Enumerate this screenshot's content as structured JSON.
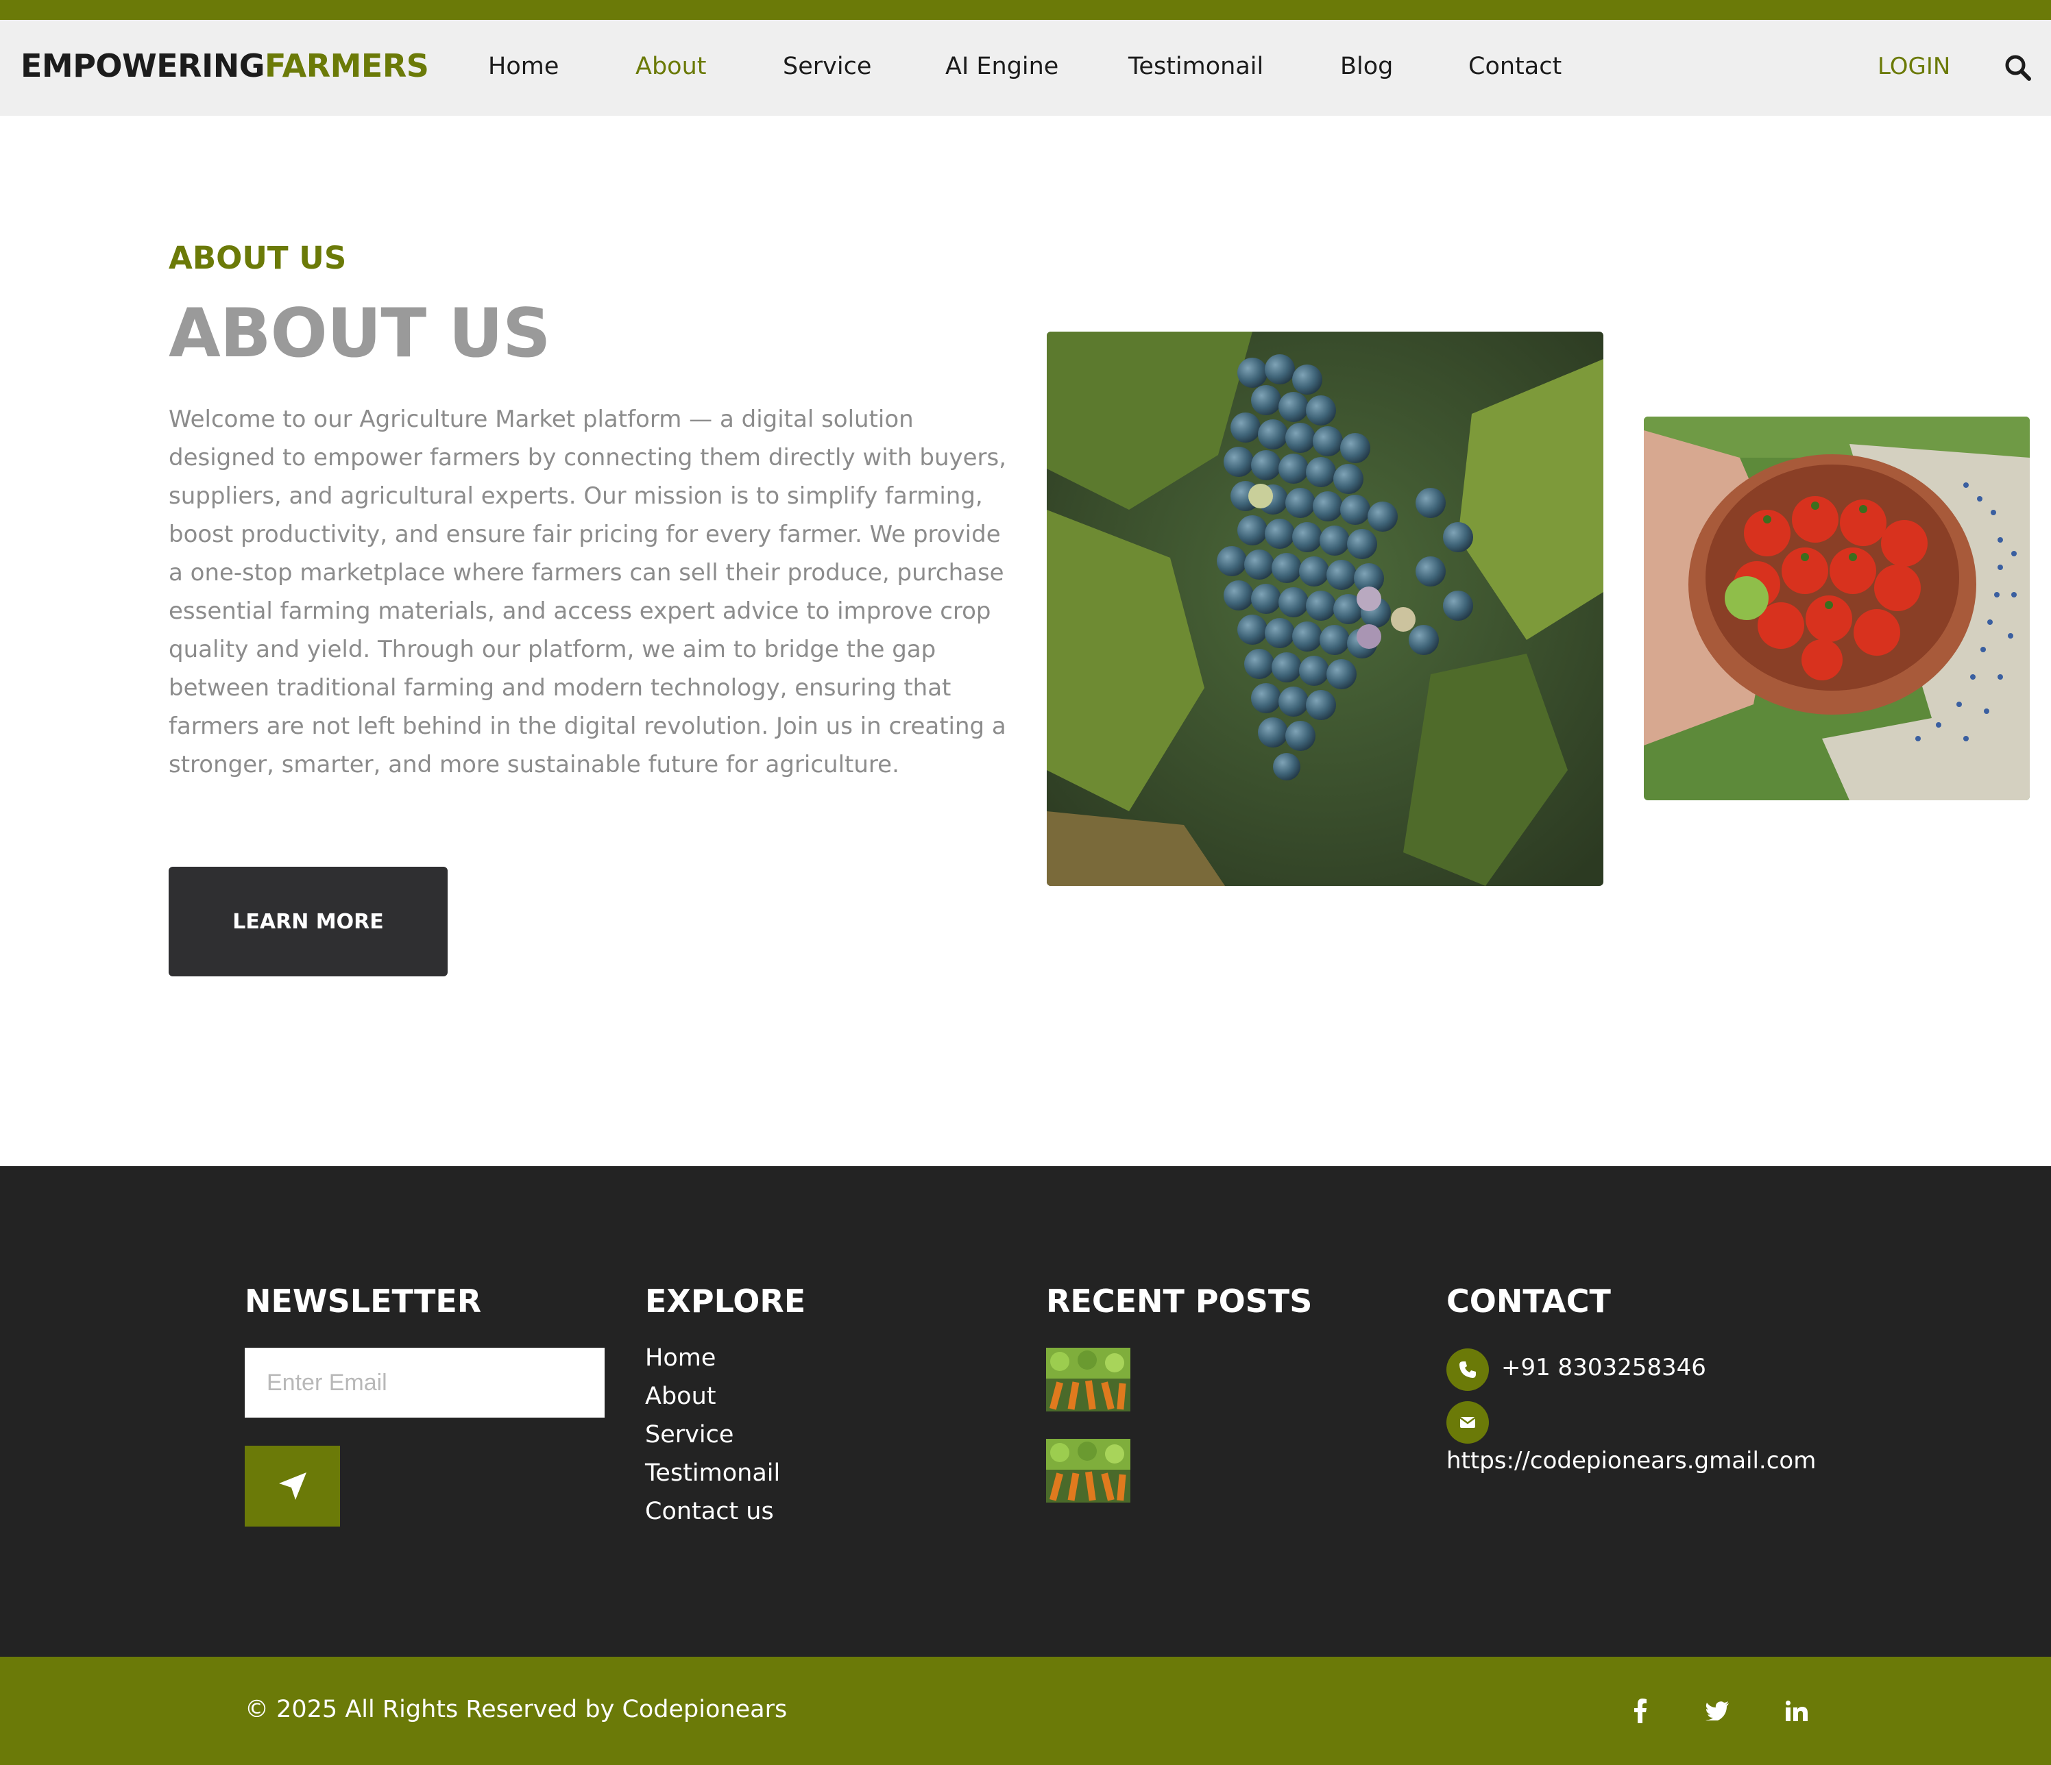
{
  "brand": {
    "part1": "EMPOWERING",
    "part2": "FARMERS",
    "accent_color": "#6b7a08",
    "dark_color": "#232323"
  },
  "nav": {
    "items": [
      {
        "label": "Home",
        "active": false
      },
      {
        "label": "About",
        "active": true
      },
      {
        "label": "Service",
        "active": false
      },
      {
        "label": "AI Engine",
        "active": false
      },
      {
        "label": "Testimonail",
        "active": false
      },
      {
        "label": "Blog",
        "active": false
      },
      {
        "label": "Contact",
        "active": false
      }
    ],
    "login": "LOGIN",
    "search_icon": "search-icon"
  },
  "about": {
    "eyebrow": "ABOUT US",
    "title": "ABOUT US",
    "body": "Welcome to our Agriculture Market platform — a digital solution designed to empower farmers by connecting them directly with buyers, suppliers, and agricultural experts. Our mission is to simplify farming, boost productivity, and ensure fair pricing for every farmer. We provide a one-stop marketplace where farmers can sell their produce, purchase essential farming materials, and access expert advice to improve crop quality and yield. Through our platform, we aim to bridge the gap between traditional farming and modern technology, ensuring that farmers are not left behind in the digital revolution. Join us in creating a stronger, smarter, and more sustainable future for agriculture.",
    "button": "LEARN MORE"
  },
  "footer": {
    "newsletter": {
      "heading": "NEWSLETTER",
      "placeholder": "Enter Email",
      "send_icon": "send-icon"
    },
    "explore": {
      "heading": "EXPLORE",
      "links": [
        "Home",
        "About",
        "Service",
        "Testimonail",
        "Contact us"
      ]
    },
    "recent_posts": {
      "heading": "RECENT POSTS"
    },
    "contact": {
      "heading": "CONTACT",
      "phone": "+91 8303258346",
      "email": "https://codepionears.gmail.com"
    }
  },
  "bottom": {
    "copyright": "© 2025 All Rights Reserved by Codepionears",
    "social_icons": [
      "facebook-icon",
      "twitter-icon",
      "linkedin-icon"
    ]
  }
}
